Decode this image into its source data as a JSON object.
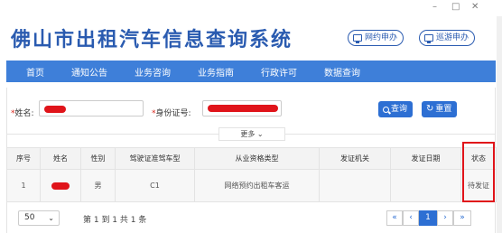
{
  "window": {
    "min": "–",
    "max": "□",
    "close": "✕"
  },
  "header": {
    "title": "佛山市出租汽车信息查询系统",
    "btn_online": "网约申办",
    "btn_cruise": "巡游申办"
  },
  "nav": {
    "items": [
      "首页",
      "通知公告",
      "业务咨询",
      "业务指南",
      "行政许可",
      "数据查询"
    ]
  },
  "search": {
    "name_label": "姓名:",
    "id_label": "身份证号:",
    "required_mark": "*",
    "search_btn": "查询",
    "reset_btn": "重置",
    "more": "更多 ⌄"
  },
  "table": {
    "headers": [
      "序号",
      "姓名",
      "性别",
      "驾驶证准驾车型",
      "从业资格类型",
      "发证机关",
      "发证日期",
      "状态"
    ],
    "rows": [
      {
        "index": "1",
        "gender": "男",
        "license": "C1",
        "qual": "网络预约出租车客运",
        "issuer": "",
        "date": "",
        "status": "待发证"
      }
    ]
  },
  "pagination": {
    "page_size": "50",
    "info": "第 1 到 1 共 1 条",
    "first": "«",
    "prev": "‹",
    "current": "1",
    "next": "›",
    "last": "»"
  },
  "colors": {
    "primary": "#2d6fd3",
    "nav": "#3e7fd9",
    "redact": "#e0141a"
  }
}
